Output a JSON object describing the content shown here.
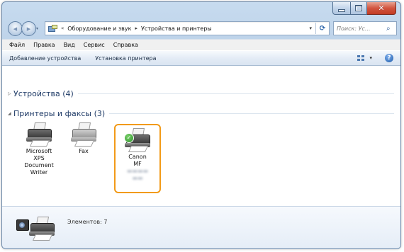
{
  "window": {
    "caption_buttons": {
      "minimize": "–",
      "maximize": "□",
      "close": "✕"
    }
  },
  "nav": {
    "back_glyph": "◀",
    "forward_glyph": "▶",
    "recent_glyph": "▾"
  },
  "address": {
    "prefix": "«",
    "crumbs": [
      "Оборудование и звук",
      "Устройства и принтеры"
    ],
    "separator": "▸",
    "dropdown_glyph": "▾",
    "refresh_glyph": "⟳"
  },
  "search": {
    "placeholder": "Поиск: Ус...",
    "icon": "search-icon"
  },
  "menu": [
    "Файл",
    "Правка",
    "Вид",
    "Сервис",
    "Справка"
  ],
  "commands": {
    "add_device": "Добавление устройства",
    "add_printer": "Установка принтера",
    "view_dropdown": "▾",
    "help": "?"
  },
  "groups": {
    "devices": {
      "title": "Устройства (4)",
      "collapsed_glyph": "▷"
    },
    "printers": {
      "title": "Принтеры и факсы (3)",
      "expanded_glyph": "◢"
    }
  },
  "items": [
    {
      "label_lines": [
        "Microsoft",
        "XPS",
        "Document",
        "Writer"
      ]
    },
    {
      "label_lines": [
        "Fax"
      ]
    },
    {
      "label_lines": [
        "Canon",
        "MF"
      ],
      "default": true,
      "check": "✓"
    }
  ],
  "details": {
    "status": "Элементов: 7"
  },
  "colors": {
    "selection_border": "#f29a18",
    "title_blue": "#1e3a66",
    "window_frame": "#a9c1dd"
  }
}
